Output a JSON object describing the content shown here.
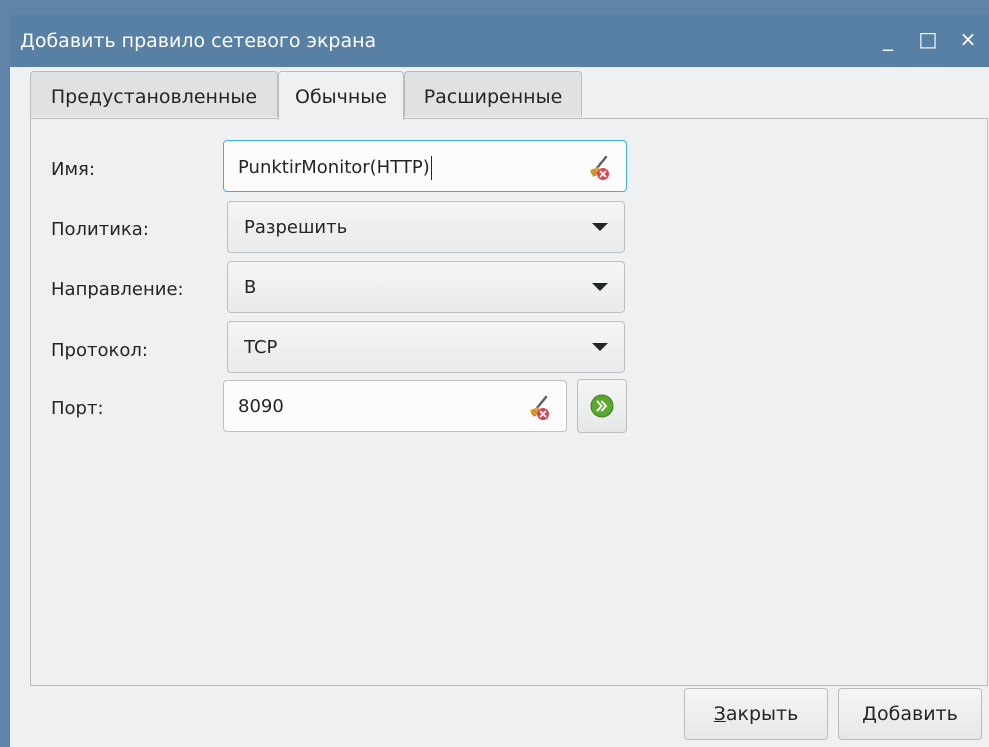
{
  "window": {
    "title": "Добавить правило сетевого экрана",
    "minimize_glyph": "_",
    "maximize_glyph": "□",
    "close_glyph": "×"
  },
  "tabs": [
    {
      "label": "Предустановленные",
      "active": false
    },
    {
      "label": "Обычные",
      "active": true
    },
    {
      "label": "Расширенные",
      "active": false
    }
  ],
  "form": {
    "name_label": "Имя:",
    "name_value": "PunktirMonitor(HTTP)",
    "policy_label": "Политика:",
    "policy_value": "Разрешить",
    "direction_label": "Направление:",
    "direction_value": "В",
    "protocol_label": "Протокол:",
    "protocol_value": "TCP",
    "port_label": "Порт:",
    "port_value": "8090"
  },
  "buttons": {
    "close_mnemonic": "З",
    "close_rest": "акрыть",
    "add_mnemonic": "Д",
    "add_rest": "обавить"
  },
  "icons": {
    "clear": "edit-clear-icon",
    "go": "go-next-icon",
    "accent": "#3daee9",
    "titlebar": "#587fa4",
    "go_green": "#5aa72f"
  }
}
